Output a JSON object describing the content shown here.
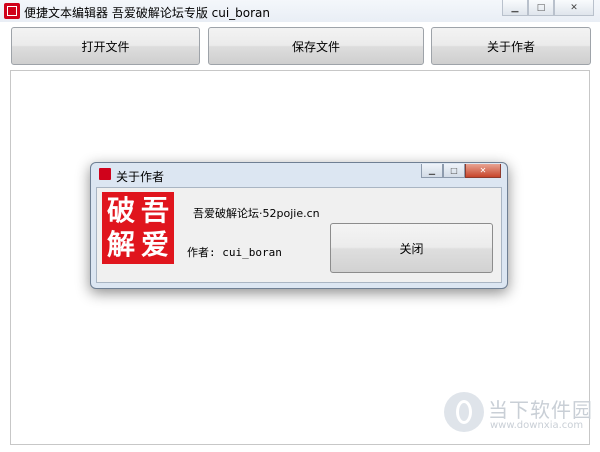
{
  "window": {
    "title": "便捷文本编辑器  吾爱破解论坛专版 cui_boran",
    "minimize_glyph": "▁",
    "maximize_glyph": "□",
    "close_glyph": "✕"
  },
  "toolbar": {
    "open_label": "打开文件",
    "save_label": "保存文件",
    "about_label": "关于作者"
  },
  "dialog": {
    "title": "关于作者",
    "seal_chars": [
      "破",
      "吾",
      "解",
      "爱"
    ],
    "site_text": "吾爱破解论坛·52pojie.cn",
    "author_text": "作者: cui_boran",
    "close_label": "关闭",
    "minimize_glyph": "▁",
    "maximize_glyph": "□",
    "close_glyph": "✕"
  },
  "watermark": {
    "name": "当下软件园",
    "url": "www.downxia.com"
  },
  "colors": {
    "seal_red": "#e0151d",
    "dialog_frame": "#dce6f2"
  }
}
